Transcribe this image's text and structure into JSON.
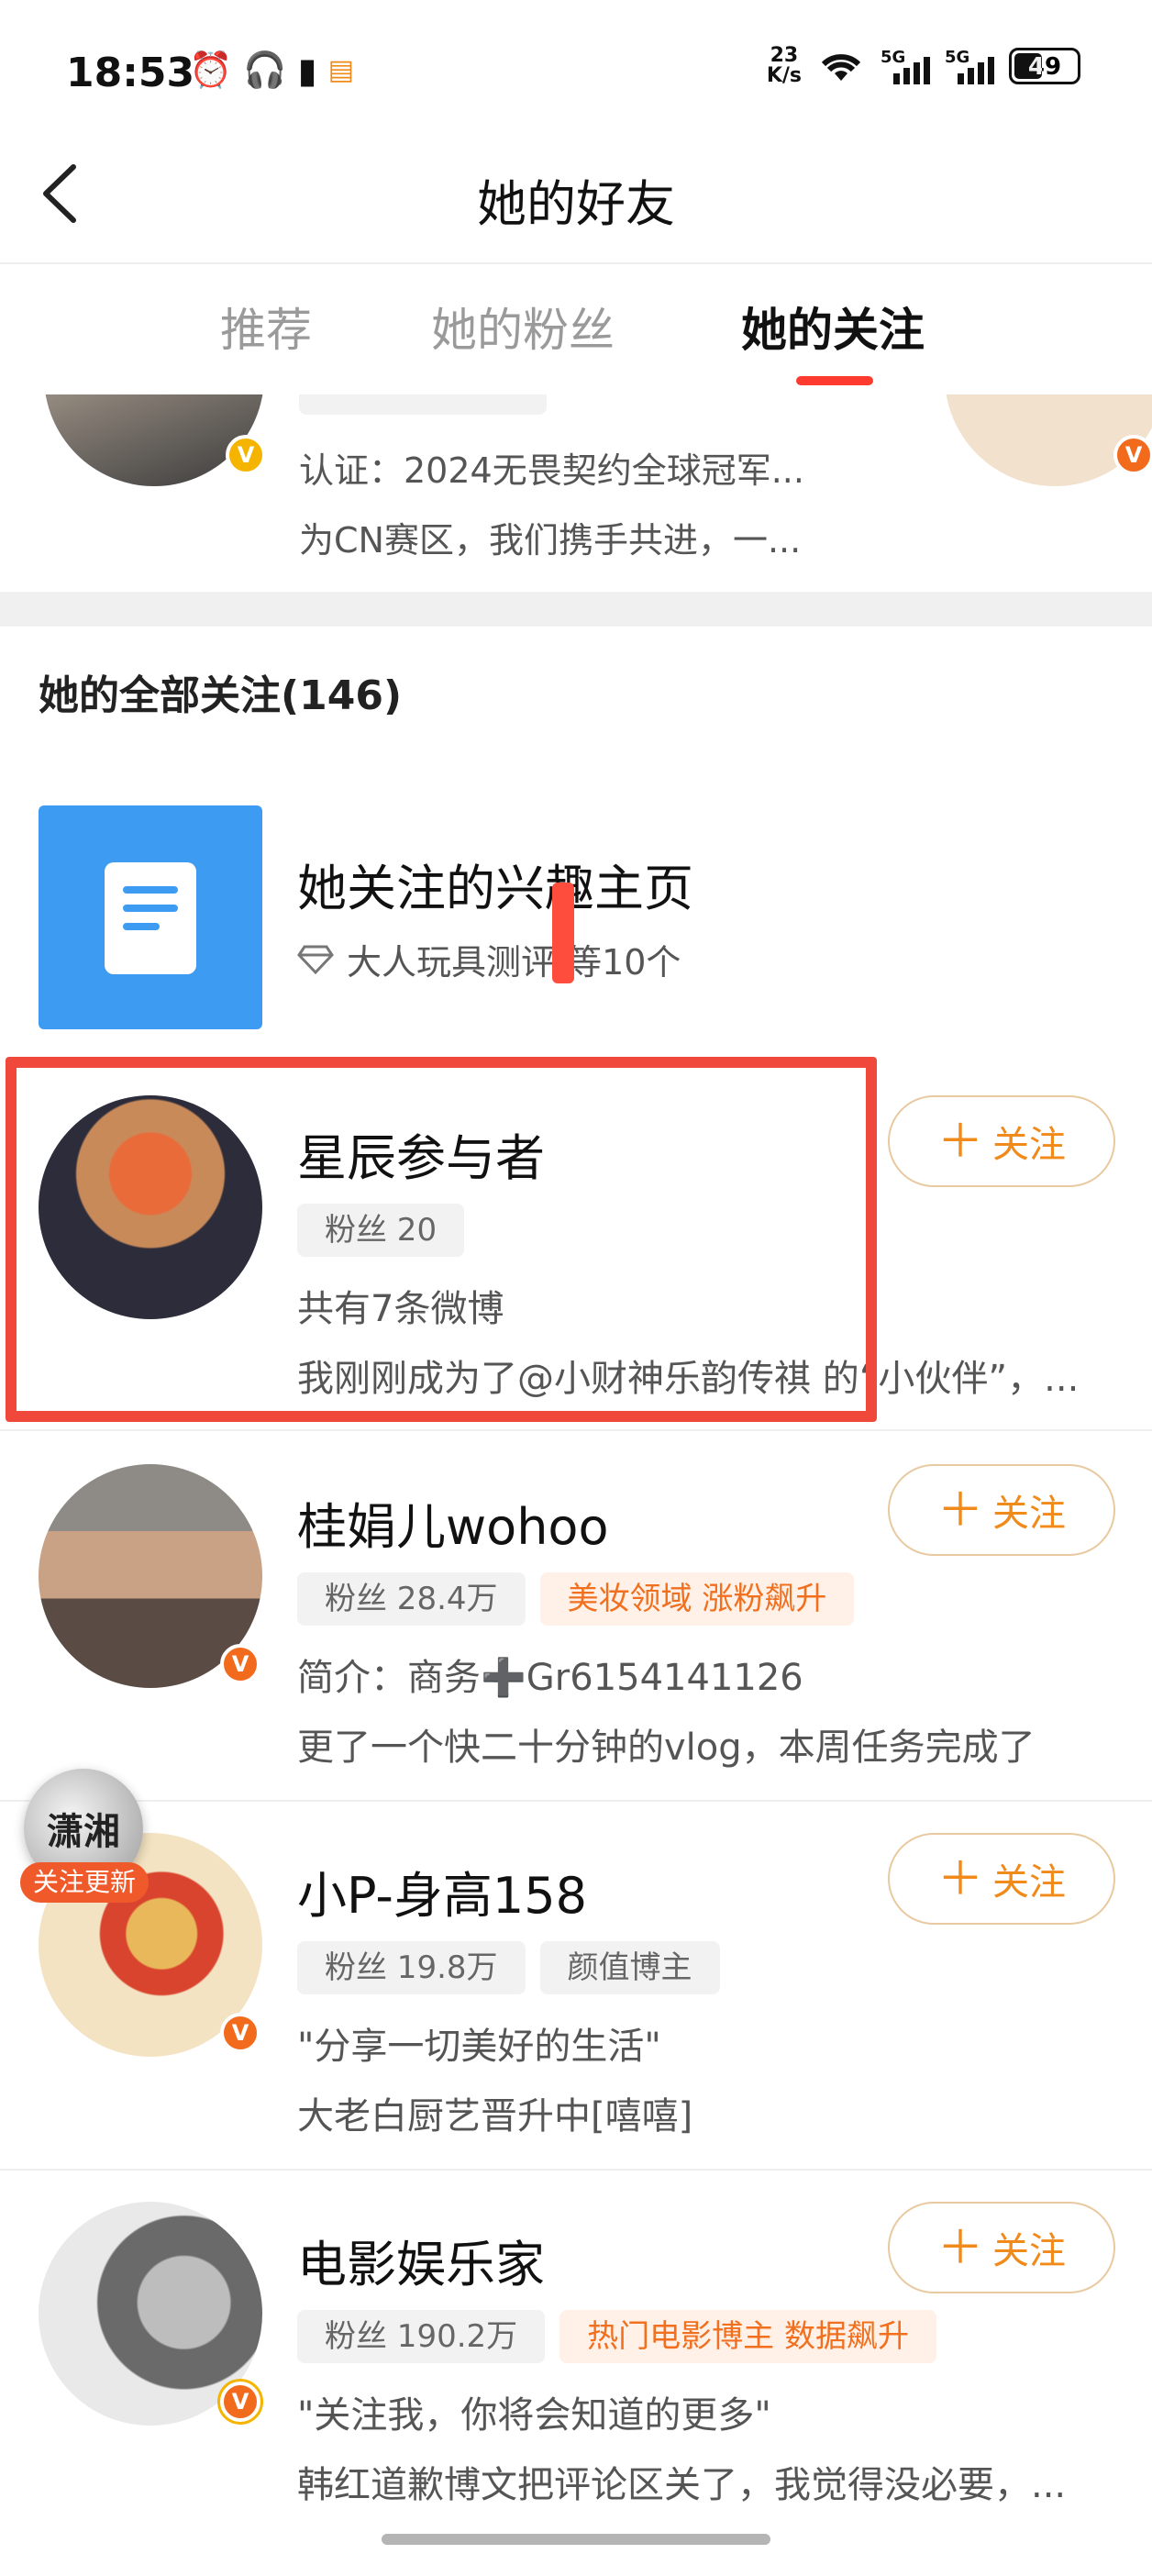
{
  "status_bar": {
    "time": "18:53",
    "net_speed_value": "23",
    "net_speed_unit": "K/s",
    "sim1_label": "5G",
    "sim2_label": "5G",
    "battery": "49",
    "left_icons": [
      "alarm-icon",
      "headphones-icon",
      "battery-saver-icon",
      "app-notification-icon"
    ]
  },
  "nav": {
    "title": "她的好友"
  },
  "tabs": [
    {
      "label": "推荐",
      "active": false
    },
    {
      "label": "她的粉丝",
      "active": false
    },
    {
      "label": "她的关注",
      "active": true
    }
  ],
  "partial_card": {
    "line1": "认证：2024无畏契约全球冠军...",
    "line2": "为CN赛区，我们携手共进，一..."
  },
  "section": {
    "title": "她的全部关注(146)"
  },
  "interest": {
    "title": "她关注的兴趣主页",
    "subtitle": "大人玩具测评 等10个"
  },
  "users": [
    {
      "name": "星辰参与者",
      "tags": [
        {
          "text": "粉丝 20",
          "hot": false
        }
      ],
      "line1": "共有7条微博",
      "line2": "我刚刚成为了@小财神乐韵传祺 的“小伙伴”，...",
      "follow_label": "关注",
      "verified": false
    },
    {
      "name": "桂娟儿wohoo",
      "tags": [
        {
          "text": "粉丝 28.4万",
          "hot": false
        },
        {
          "text": "美妆领域 涨粉飙升",
          "hot": true
        }
      ],
      "line1": "简介：商务➕Gr6154141126",
      "line2": "更了一个快二十分钟的vlog，本周任务完成了",
      "follow_label": "关注",
      "verified": true
    },
    {
      "name": "小P-身高158",
      "tags": [
        {
          "text": "粉丝 19.8万",
          "hot": false
        },
        {
          "text": "颜值博主",
          "hot": false
        }
      ],
      "line1": "\"分享一切美好的生活\"",
      "line2": "大老白厨艺晋升中[嘻嘻]",
      "follow_label": "关注",
      "verified": true
    },
    {
      "name": "电影娱乐家",
      "tags": [
        {
          "text": "粉丝 190.2万",
          "hot": false
        },
        {
          "text": "热门电影博主 数据飙升",
          "hot": true
        }
      ],
      "line1": "\"关注我，你将会知道的更多\"",
      "line2": "韩红道歉博文把评论区关了，我觉得没必要，...",
      "follow_label": "关注",
      "verified": true
    }
  ],
  "float_badge": {
    "logo_text": "潇湘",
    "label": "关注更新"
  },
  "colors": {
    "accent": "#f08a1a",
    "tab_indicator": "#ff3b2f",
    "highlight": "#f0483a",
    "verified_orange": "#f26b1d",
    "verified_gold": "#f5b400"
  }
}
